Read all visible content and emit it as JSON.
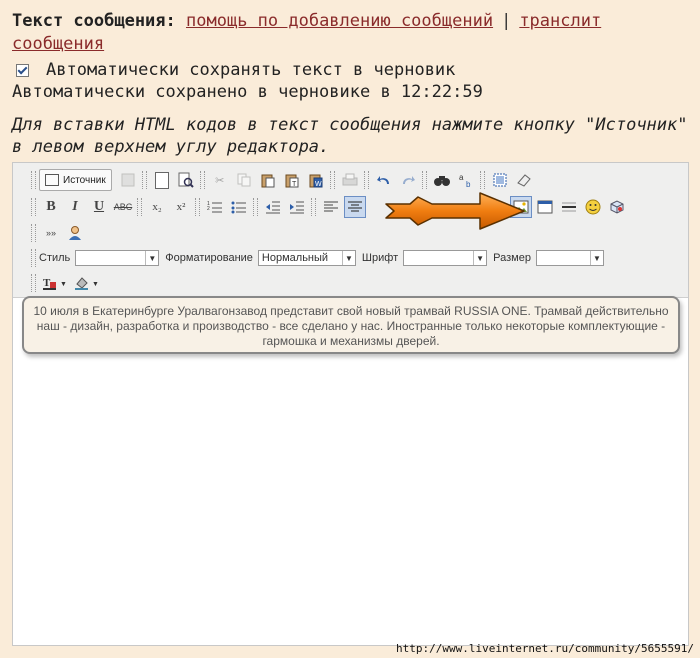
{
  "header": {
    "title": "Текст сообщения:",
    "help_link": "помощь по добавлению сообщений",
    "separator": "|",
    "translit_link": "транслит сообщения"
  },
  "autosave": {
    "checked": true,
    "label": "Автоматически сохранять текст в черновик",
    "status": "Автоматически сохранено в черновике в 12:22:59"
  },
  "hint": "Для вставки HTML кодов в текст сообщения нажмите кнопку \"Источник\" в левом верхнем углу редактора.",
  "toolbar": {
    "source_label": "Источник",
    "bold": "B",
    "italic": "I",
    "underline": "U",
    "strike": "ABC",
    "subscript": "x₂",
    "superscript": "x²",
    "more": "»»",
    "style_label": "Стиль",
    "style_value": "",
    "format_label": "Форматирование",
    "format_value": "Нормальный",
    "font_label": "Шрифт",
    "font_value": "",
    "size_label": "Размер",
    "size_value": ""
  },
  "content": {
    "text": "10 июля в Екатеринбурге Уралвагонзавод представит свой новый трамвай RUSSIA ONE. Трамвай действительно наш - дизайн, разработка и производство - все сделано у нас. Иностранные только некоторые комплектующие - гармошка и механизмы дверей."
  },
  "watermark": "http://www.liveinternet.ru/community/5655591/",
  "colors": {
    "accent": "#f28a1e",
    "link": "#8a2b2b",
    "background": "#faecd9"
  }
}
